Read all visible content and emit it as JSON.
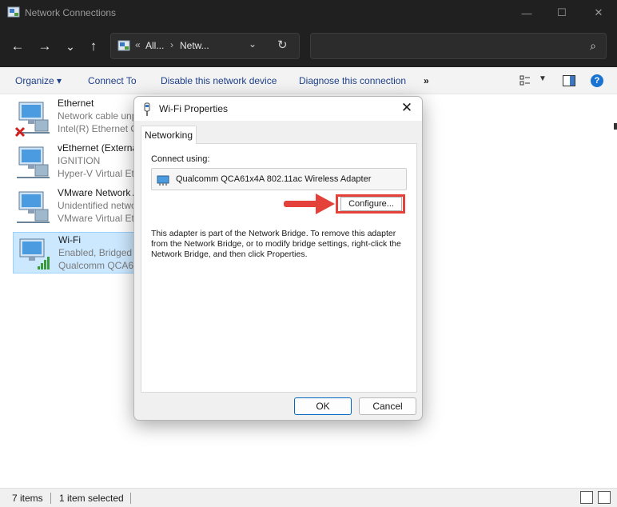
{
  "window": {
    "title": "Network Connections",
    "controls": {
      "minimize": "—",
      "maximize": "☐",
      "close": "✕"
    }
  },
  "nav": {
    "back": "←",
    "forward": "→",
    "recent": "⌄",
    "up": "↑",
    "breadcrumbs": {
      "overflow": "«",
      "crumb1": "All...",
      "sep": "›",
      "crumb2": "Netw..."
    },
    "dropdown": "⌄",
    "refresh": "↻",
    "search_placeholder": "",
    "search_icon": "⌕"
  },
  "commands": {
    "organize": "Organize ▾",
    "connect_to": "Connect To",
    "disable": "Disable this network device",
    "diagnose": "Diagnose this connection",
    "more": "»",
    "help": "?"
  },
  "connections": [
    {
      "name": "Ethernet",
      "status": "Network cable unp",
      "device": "Intel(R) Ethernet C",
      "overlay": "disconnected"
    },
    {
      "name": "vEthernet (Externa",
      "status": "IGNITION",
      "device": "Hyper-V Virtual Eth",
      "overlay": "none"
    },
    {
      "name": "VMware Network A",
      "status": "Unidentified netwo",
      "device": "VMware Virtual Eth",
      "overlay": "none"
    },
    {
      "name": "Wi-Fi",
      "status": "Enabled, Bridged",
      "device": "Qualcomm QCA61",
      "overlay": "signal",
      "selected": true
    }
  ],
  "status_bar": {
    "count": "7 items",
    "selection": "1 item selected"
  },
  "dialog": {
    "title": "Wi-Fi Properties",
    "close": "✕",
    "tab": "Networking",
    "connect_using_label": "Connect using:",
    "adapter": "Qualcomm QCA61x4A 802.11ac Wireless Adapter",
    "configure_button": "Configure...",
    "description": "This adapter is part of the Network Bridge.  To remove this adapter from the Network Bridge, or to modify bridge settings, right-click the Network Bridge, and then click Properties.",
    "ok_button": "OK",
    "cancel_button": "Cancel"
  },
  "colors": {
    "accent": "#0067c0",
    "annotation_red": "#e3413a",
    "selection": "#cce8ff"
  }
}
